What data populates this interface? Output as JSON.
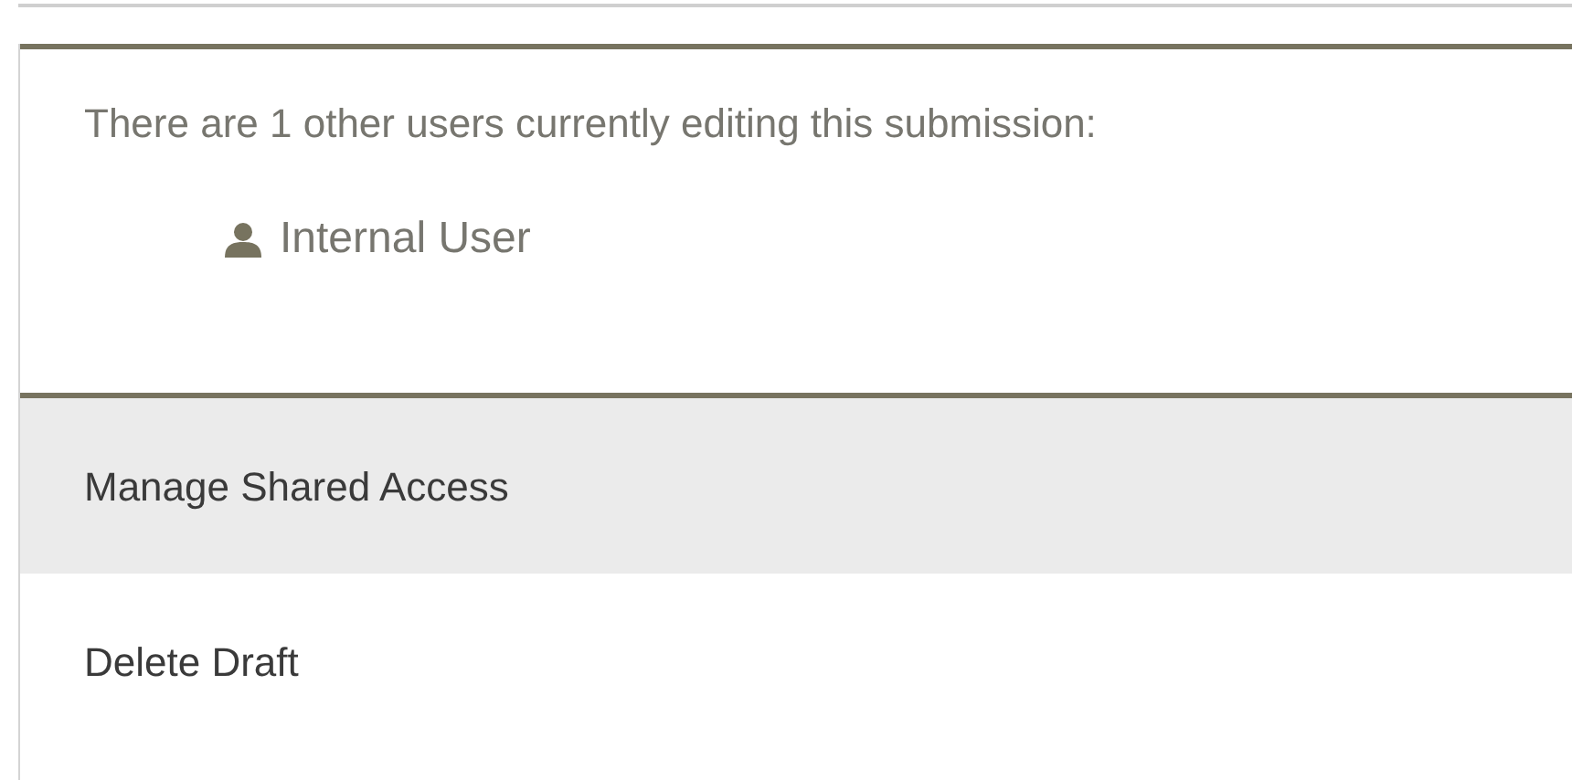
{
  "message": "There are 1 other users currently editing this submission:",
  "users": [
    {
      "name": "Internal User"
    }
  ],
  "menu": [
    {
      "label": "Manage Shared Access",
      "selected": true
    },
    {
      "label": "Delete Draft",
      "selected": false
    }
  ]
}
